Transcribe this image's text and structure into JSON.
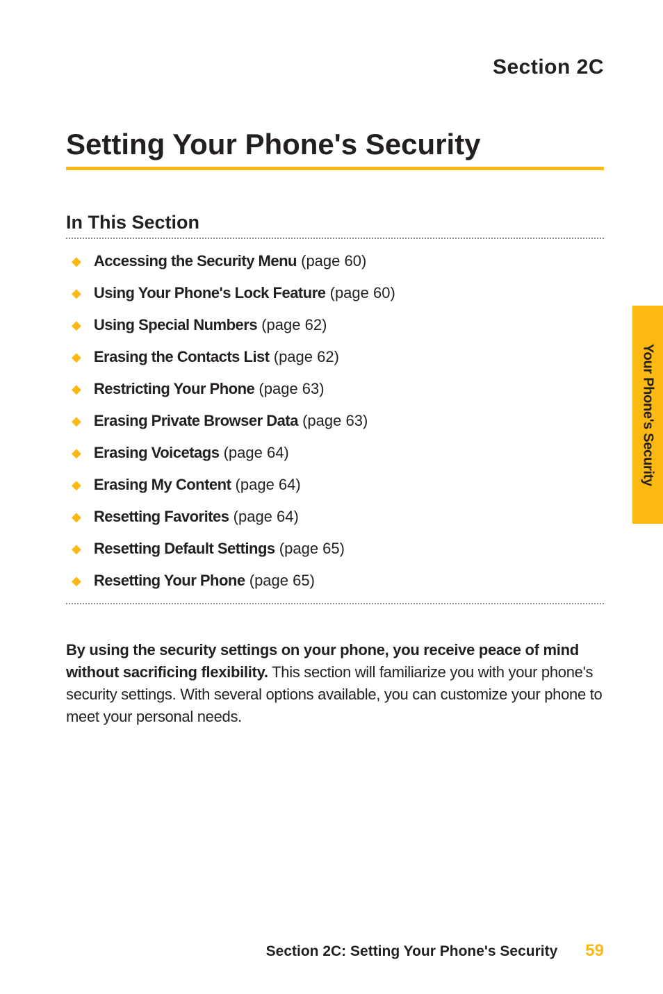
{
  "section_label": "Section 2C",
  "main_title": "Setting Your Phone's Security",
  "subsection_heading": "In This Section",
  "toc": [
    {
      "title": "Accessing the Security Menu",
      "page": "(page 60)"
    },
    {
      "title": "Using Your Phone's Lock Feature",
      "page": "(page 60)"
    },
    {
      "title": "Using Special Numbers",
      "page": "(page 62)"
    },
    {
      "title": "Erasing the Contacts List",
      "page": "(page 62)"
    },
    {
      "title": "Restricting Your Phone",
      "page": "(page 63)"
    },
    {
      "title": "Erasing Private Browser Data",
      "page": "(page 63)"
    },
    {
      "title": "Erasing Voicetags",
      "page": "(page 64)"
    },
    {
      "title": "Erasing My Content",
      "page": "(page 64)"
    },
    {
      "title": "Resetting Favorites",
      "page": "(page 64)"
    },
    {
      "title": "Resetting Default Settings",
      "page": "(page 65)"
    },
    {
      "title": "Resetting Your Phone",
      "page": "(page 65)"
    }
  ],
  "body": {
    "bold": "By using the security settings on your phone, you receive peace of mind without sacrificing flexibility.",
    "rest": " This section will familiarize you with your phone's security settings. With several options available, you can customize your phone to meet your personal needs."
  },
  "side_tab": "Your Phone's Security",
  "footer": {
    "title": "Section 2C: Setting Your Phone's Security",
    "page": "59"
  },
  "bullet_glyph": "◆"
}
